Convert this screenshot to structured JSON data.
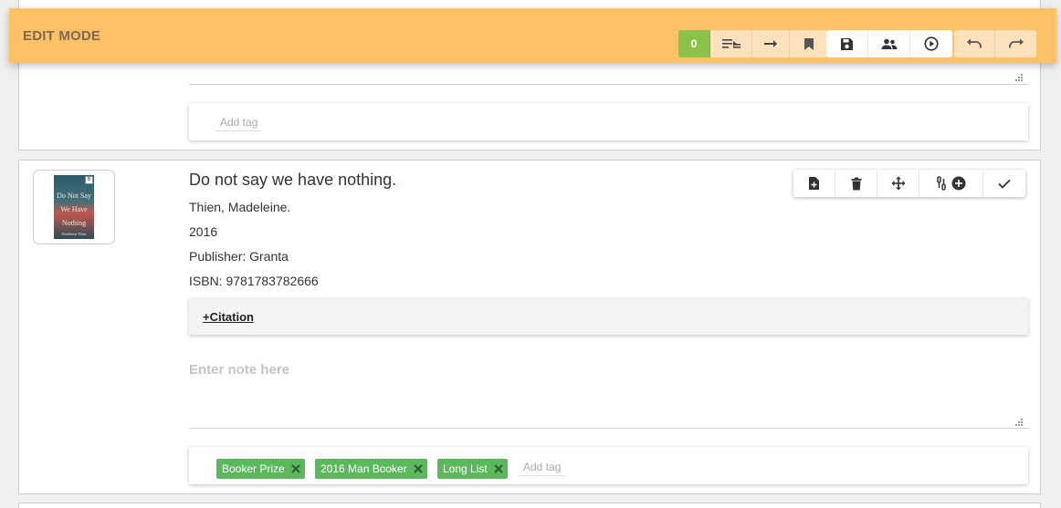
{
  "editbar": {
    "mode_label": "EDIT MODE",
    "selected_count": "0",
    "accent_color": "#ffc066",
    "count_color": "#8bc34a"
  },
  "top_record": {
    "add_tag_placeholder": "Add tag"
  },
  "record": {
    "cover_text": [
      "Do Not Say",
      "We Have",
      "Nothing"
    ],
    "cover_author": "Madeleine Thien",
    "title": "Do not say we have nothing.",
    "author": "Thien, Madeleine.",
    "year": "2016",
    "publisher": "Publisher: Granta",
    "isbn": "ISBN: 9781783782666",
    "citation_link": "+Citation",
    "note_placeholder": "Enter note here",
    "tags": [
      {
        "label": "Booker Prize"
      },
      {
        "label": "2016 Man Booker"
      },
      {
        "label": "Long List"
      }
    ],
    "add_tag_placeholder": "Add tag",
    "tag_color": "#5cb85c"
  }
}
